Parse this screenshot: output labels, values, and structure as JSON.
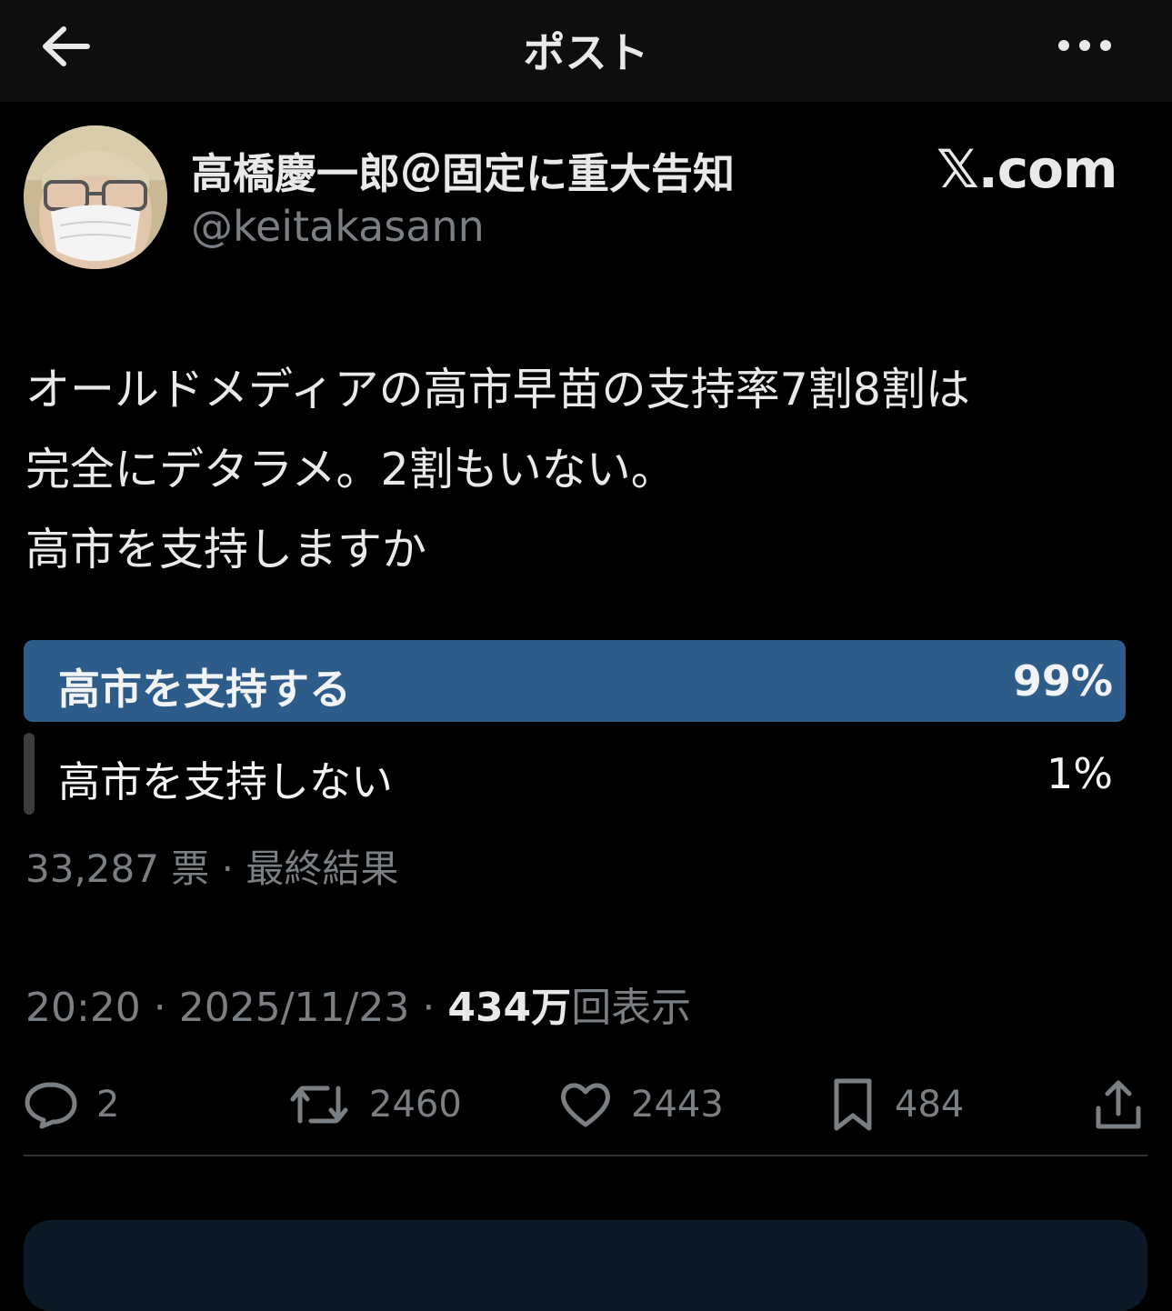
{
  "topbar": {
    "title": "ポスト"
  },
  "author": {
    "name": "高橋慶一郎＠固定に重大告知",
    "handle": "@keitakasann"
  },
  "watermark": "𝕏.com",
  "post": {
    "text_line1": "オールドメディアの高市早苗の支持率7割8割は",
    "text_line2": "完全にデタラメ。2割もいない。",
    "text_line3": "高市を支持しますか"
  },
  "poll": {
    "options": [
      {
        "label": "高市を支持する",
        "percent_label": "99%",
        "percent": 99
      },
      {
        "label": "高市を支持しない",
        "percent_label": "1%",
        "percent": 1
      }
    ],
    "meta": "33,287 票 · 最終結果",
    "winner_color": "#2d5b8a",
    "loser_color": "#3a3d40"
  },
  "timestamp": {
    "time_date": "20:20 · 2025/11/23 · ",
    "views_count": "434万",
    "views_label": "回表示"
  },
  "actions": {
    "reply_count": "2",
    "repost_count": "2460",
    "like_count": "2443",
    "bookmark_count": "484"
  },
  "icons": [
    "back-arrow-icon",
    "more-icon",
    "reply-icon",
    "repost-icon",
    "like-icon",
    "bookmark-icon",
    "share-icon"
  ]
}
